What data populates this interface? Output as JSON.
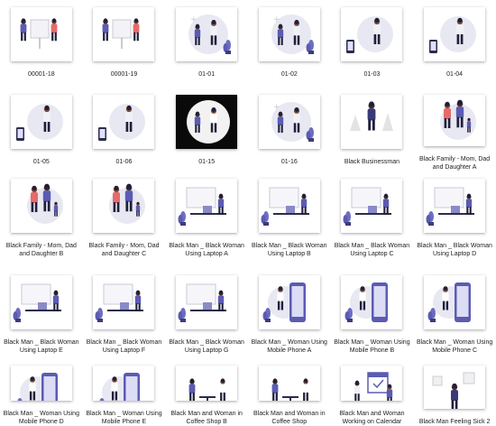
{
  "colors": {
    "accent": "#5b5bb3",
    "skin_dark": "#4a2a1e",
    "skin_mid": "#7a4a34",
    "hair": "#1f1f3a",
    "blob": "#e8e8f2",
    "coral": "#e66a6a",
    "plant": "#6d6dc0"
  },
  "files": [
    {
      "label": "00001-18",
      "icon": "two-people-presentation"
    },
    {
      "label": "00001-19",
      "icon": "two-people-presentation"
    },
    {
      "label": "01-01",
      "icon": "doctor-patient"
    },
    {
      "label": "01-02",
      "icon": "doctor-patient"
    },
    {
      "label": "01-03",
      "icon": "doctor-phone"
    },
    {
      "label": "01-04",
      "icon": "doctor-phone"
    },
    {
      "label": "01-05",
      "icon": "doctor-phone"
    },
    {
      "label": "01-06",
      "icon": "doctor-phone"
    },
    {
      "label": "01-15",
      "icon": "doctor-patient-dark"
    },
    {
      "label": "01-16",
      "icon": "doctor-patient"
    },
    {
      "label": "Black Businessman",
      "icon": "businessman"
    },
    {
      "label": "Black Family - Mom, Dad and Daughter A",
      "icon": "family"
    },
    {
      "label": "Black Family - Mom, Dad and Daughter B",
      "icon": "family"
    },
    {
      "label": "Black Family - Mom, Dad and Daughter C",
      "icon": "family"
    },
    {
      "label": "Black Man _ Black Woman Using Laptop A",
      "icon": "laptop-desk"
    },
    {
      "label": "Black Man _ Black Woman Using Laptop B",
      "icon": "laptop-desk"
    },
    {
      "label": "Black Man _ Black Woman Using Laptop C",
      "icon": "laptop-desk"
    },
    {
      "label": "Black Man _ Black Woman Using Laptop D",
      "icon": "laptop-desk"
    },
    {
      "label": "Black Man _ Black Woman Using Laptop E",
      "icon": "laptop-desk"
    },
    {
      "label": "Black Man _ Black Woman Using Laptop F",
      "icon": "laptop-desk"
    },
    {
      "label": "Black Man _ Black Woman Using Laptop G",
      "icon": "laptop-desk"
    },
    {
      "label": "Black Man _ Woman Using Mobile Phone A",
      "icon": "mobile-phone"
    },
    {
      "label": "Black Man _ Woman Using Mobile Phone B",
      "icon": "mobile-phone"
    },
    {
      "label": "Black Man _ Woman Using Mobile Phone C",
      "icon": "mobile-phone"
    },
    {
      "label": "Black Man _ Woman Using Mobile Phone D",
      "icon": "mobile-phone"
    },
    {
      "label": "Black Man _ Woman Using Mobile Phone E",
      "icon": "mobile-phone"
    },
    {
      "label": "Black Man and Woman in Coffee Shop B",
      "icon": "coffee-shop"
    },
    {
      "label": "Black Man and Woman in Coffee Shop",
      "icon": "coffee-shop"
    },
    {
      "label": "Black Man and Woman Working on Calendar",
      "icon": "calendar"
    },
    {
      "label": "Black Man Feeling Sick 2",
      "icon": "sick-man"
    }
  ]
}
